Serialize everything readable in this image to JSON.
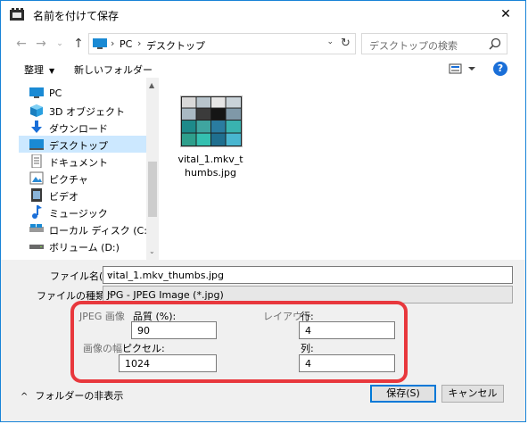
{
  "window": {
    "title": "名前を付けて保存",
    "close_glyph": "✕"
  },
  "nav": {
    "back_glyph": "←",
    "forward_glyph": "→",
    "recent_glyph": "⌄",
    "up_glyph": "↑",
    "address_segments": [
      "PC",
      "デスクトップ"
    ],
    "address_sep": "›",
    "address_dropdown_glyph": "⌄",
    "refresh_glyph": "↻",
    "search_placeholder": "デスクトップの検索"
  },
  "toolbar": {
    "organize_label": "整理",
    "organize_caret": "▼",
    "new_folder_label": "新しいフォルダー",
    "help_glyph": "?"
  },
  "tree": {
    "items": [
      {
        "label": "PC",
        "icon": "pc-icon"
      },
      {
        "label": "3D オブジェクト",
        "icon": "cube-icon"
      },
      {
        "label": "ダウンロード",
        "icon": "download-icon"
      },
      {
        "label": "デスクトップ",
        "icon": "desktop-icon",
        "selected": true
      },
      {
        "label": "ドキュメント",
        "icon": "document-icon"
      },
      {
        "label": "ピクチャ",
        "icon": "picture-icon"
      },
      {
        "label": "ビデオ",
        "icon": "video-icon"
      },
      {
        "label": "ミュージック",
        "icon": "music-icon"
      },
      {
        "label": "ローカル ディスク (C:)",
        "icon": "drive-c-icon"
      },
      {
        "label": "ボリューム (D:)",
        "icon": "drive-d-icon"
      }
    ],
    "scroll_up_glyph": "▲",
    "scroll_down_glyph": "⌄"
  },
  "files": [
    {
      "name": "vital_1.mkv_thumbs.jpg"
    }
  ],
  "form": {
    "filename_label": "ファイル名(N):",
    "filename_value": "vital_1.mkv_thumbs.jpg",
    "filetype_label": "ファイルの種類(T):",
    "filetype_value": "JPG - JPEG Image (*.jpg)",
    "dropdown_glyph": "⌄"
  },
  "options": {
    "jpeg_group": "JPEG 画像",
    "quality_label": "品質 (%):",
    "quality_value": "90",
    "width_group": "画像の幅",
    "pixels_label": "ピクセル:",
    "pixels_value": "1024",
    "layout_group": "レイアウト",
    "rows_label": "行:",
    "rows_value": "4",
    "cols_label": "列:",
    "cols_value": "4"
  },
  "footer": {
    "hide_folders_chevron": "^",
    "hide_folders_label": "フォルダーの非表示",
    "save_label": "保存(S)",
    "cancel_label": "キャンセル"
  },
  "colors": {
    "accent": "#0078d7",
    "highlight_border": "#e8383d",
    "selected_bg": "#cce8ff",
    "title_bar": "#ffffff"
  }
}
